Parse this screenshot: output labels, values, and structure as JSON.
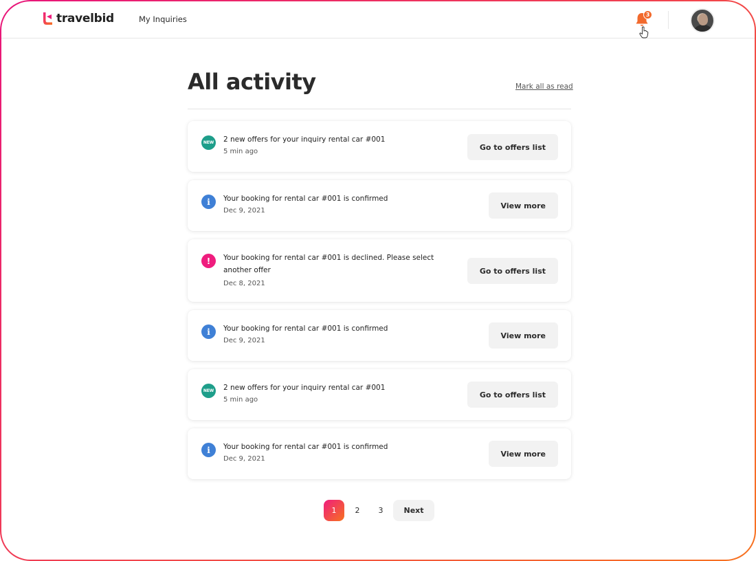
{
  "header": {
    "brand": "travelbid",
    "nav_link": "My Inquiries",
    "notification_count": "3"
  },
  "main": {
    "title": "All activity",
    "mark_all_read": "Mark all as read"
  },
  "activities": [
    {
      "icon": "new-badge-icon",
      "message": "2 new offers for your inquiry rental car #001",
      "time": "5 min ago",
      "action": "Go to offers list"
    },
    {
      "icon": "info-icon",
      "message": "Your booking for rental car #001 is confirmed",
      "time": "Dec 9, 2021",
      "action": "View more"
    },
    {
      "icon": "alert-icon",
      "message": "Your booking for rental car #001 is declined. Please select another offer",
      "time": "Dec 8, 2021",
      "action": "Go to offers list"
    },
    {
      "icon": "info-icon",
      "message": "Your booking for rental car #001 is confirmed",
      "time": "Dec 9, 2021",
      "action": "View more"
    },
    {
      "icon": "new-badge-icon",
      "message": "2 new offers for your inquiry rental car #001",
      "time": "5 min ago",
      "action": "Go to offers list"
    },
    {
      "icon": "info-icon",
      "message": "Your booking for rental car #001 is confirmed",
      "time": "Dec 9, 2021",
      "action": "View more"
    }
  ],
  "icon_labels": {
    "new": "NEW",
    "info": "i",
    "alert": "!"
  },
  "pagination": {
    "pages": [
      "1",
      "2",
      "3"
    ],
    "current": "1",
    "next": "Next"
  },
  "colors": {
    "brand_gradient_start": "#ef1d7e",
    "brand_gradient_end": "#f7721f",
    "new_badge": "#1e9e8a",
    "info": "#3f80d6",
    "alert": "#ef1d7e",
    "notification": "#f26a2d"
  }
}
